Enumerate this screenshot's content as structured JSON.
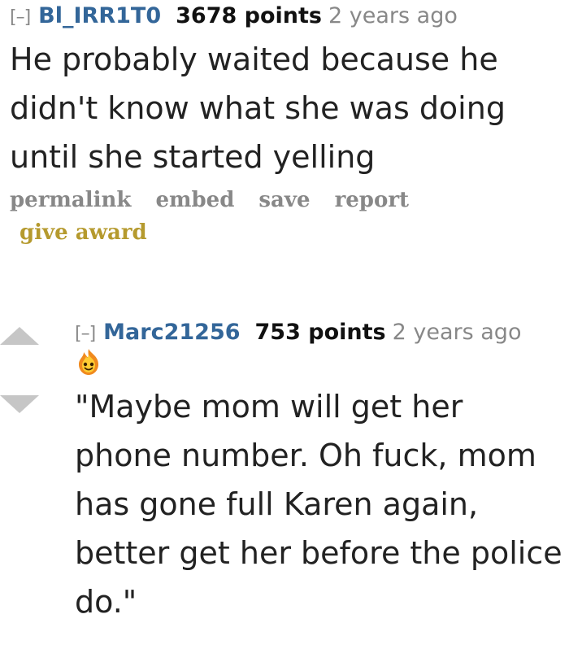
{
  "comment1": {
    "collapse": "[–]",
    "author": "Bl_IRR1T0",
    "score": "3678 points",
    "time": "2 years ago",
    "text": "He probably waited because he didn't know what she was doing until she started yelling"
  },
  "buttons": {
    "permalink": "permalink",
    "embed": "embed",
    "save": "save",
    "report": "report",
    "give_award": "give award"
  },
  "comment2": {
    "collapse": "[–]",
    "author": "Marc21256",
    "score": "753 points",
    "time": "2 years ago",
    "flair_icon": "fire-face-flair-icon",
    "text": "\"Maybe mom will get her phone number. Oh fuck, mom has gone full Karen again, better get her before the police do.\""
  },
  "colors": {
    "author": "#336699",
    "muted": "#888888",
    "award": "#b59a2e",
    "vote_arrow": "#c6c6c6"
  }
}
